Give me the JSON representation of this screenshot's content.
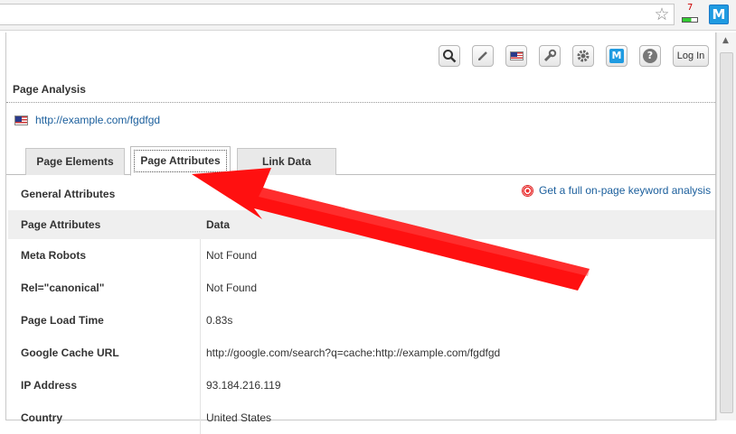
{
  "browser": {
    "star_icon": "star-icon",
    "badge_count": "7",
    "extension_label": "M"
  },
  "toolbar": {
    "icons": [
      "search-icon",
      "pencil-icon",
      "flag-icon",
      "wrench-icon",
      "gear-icon",
      "moz-icon",
      "help-icon"
    ],
    "login_label": "Log In"
  },
  "page": {
    "section_title": "Page Analysis",
    "url": "http://example.com/fgdfgd"
  },
  "tabs": [
    {
      "label": "Page Elements",
      "active": false
    },
    {
      "label": "Page Attributes",
      "active": true
    },
    {
      "label": "Link Data",
      "active": false
    }
  ],
  "attributes": {
    "heading": "General Attributes",
    "keyword_link": "Get a full on-page keyword analysis",
    "columns": [
      "Page Attributes",
      "Data"
    ],
    "rows": [
      {
        "name": "Meta Robots",
        "value": "Not Found"
      },
      {
        "name": "Rel=\"canonical\"",
        "value": "Not Found"
      },
      {
        "name": "Page Load Time",
        "value": "0.83s"
      },
      {
        "name": "Google Cache URL",
        "value": "http://google.com/search?q=cache:http://example.com/fgdfgd"
      },
      {
        "name": "IP Address",
        "value": "93.184.216.119"
      },
      {
        "name": "Country",
        "value": "United States"
      }
    ]
  },
  "colors": {
    "link": "#1a5e9c",
    "arrow": "#ff1010",
    "moz_blue": "#1f9be1"
  }
}
